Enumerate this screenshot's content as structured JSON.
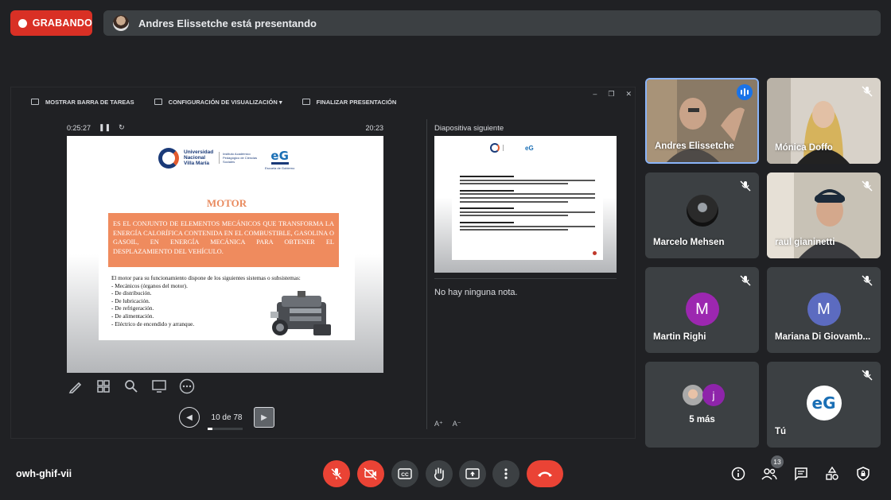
{
  "recording": {
    "label": "GRABANDO"
  },
  "presenting": {
    "text": "Andres Elissetche está presentando"
  },
  "presenter_view": {
    "toolbar": {
      "taskbar": "MOSTRAR BARRA DE TAREAS",
      "display_settings": "CONFIGURACIÓN DE VISUALIZACIÓN ▾",
      "end": "FINALIZAR PRESENTACIÓN"
    },
    "elapsed": "0:25:27",
    "pause_icon": "❚❚",
    "reset_icon": "↻",
    "clock": "20:23",
    "slide": {
      "university": "Universidad Nacional Villa María",
      "institute": "Instituto Académico Pedagógico de Ciencias Sociales",
      "eg_logo": "eG",
      "eg_caption": "Escuela de Gobierno",
      "title": "MOTOR",
      "definition": "ES EL CONJUNTO DE ELEMENTOS MECÁNICOS QUE TRANSFORMA LA ENERGÍA CALORÍFICA CONTENIDA EN EL COMBUSTIBLE, GASOLINA O GASOIL, EN ENERGÍA MECÁNICA PARA OBTENER EL DESPLAZAMIENTO DEL VEHÍCULO.",
      "intro": "El motor para su funcionamiento dispone de los siguientes sistemas o subsistemas:",
      "items": [
        "- Mecánicos (órganos del motor).",
        "- De distribución.",
        "- De lubricación.",
        "- De refrigeración.",
        "- De alimentación.",
        "- Eléctrico de encendido y arranque."
      ]
    },
    "page_indicator": "10 de 78",
    "page_progress": 0.128,
    "next_label": "Diapositiva siguiente",
    "notes": "No hay ninguna nota.",
    "tools": [
      "pen-icon",
      "grid-icon",
      "zoom-icon",
      "screen-icon",
      "more-icon"
    ]
  },
  "participants": [
    {
      "name": "Andres Elissetche",
      "speaking": true
    },
    {
      "name": "Mónica Doffo",
      "muted": true
    },
    {
      "name": "Marcelo Mehsen",
      "muted": true
    },
    {
      "name": "raul gianinetti",
      "muted": true
    },
    {
      "name": "Martin Righi",
      "initial": "M",
      "color": "#9c27b0",
      "muted": true
    },
    {
      "name": "Mariana Di Giovamb...",
      "initial": "M",
      "color": "#5c6bc0",
      "muted": true
    },
    {
      "name": "5 más",
      "extra_initial": "j"
    },
    {
      "name": "Tú",
      "muted": true,
      "logo": "eG"
    }
  ],
  "bottom": {
    "meeting_code": "owh-ghif-vii",
    "people_count": "13"
  },
  "colors": {
    "record": "#d93025",
    "danger": "#ea4335",
    "accent": "#1a73e8",
    "slide_orange": "#ef8b5e"
  }
}
